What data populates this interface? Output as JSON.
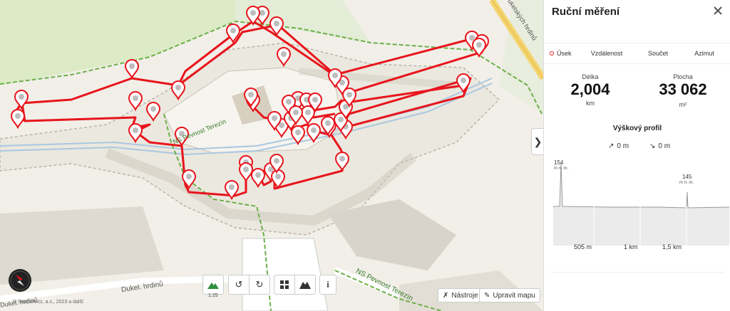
{
  "map": {
    "street_labels": [
      "Dukelských hrdinů",
      "NS Pevnost Terezín",
      "NS Pevnost Terezín",
      "Dukel. hrdinů",
      "Dukel. hrdinů"
    ],
    "copyright": "© Seznam.cz, a.s., 2023 a další",
    "zoom_label": "1:25",
    "tools_label": "Nástroje",
    "edit_label": "Upravit mapu",
    "info_label": "i",
    "route_color": "#e8141c"
  },
  "panel": {
    "title": "Ruční měření",
    "tabs": [
      "Úsek",
      "Vzdálenost",
      "Součet",
      "Azimut"
    ],
    "length_label": "Délka",
    "length_value": "2,004",
    "length_unit": "km",
    "area_label": "Plocha",
    "area_value": "33 062",
    "area_unit": "m²",
    "profile_title": "Výškový profil",
    "ascent": "0 m",
    "descent": "0 m",
    "peak1_value": "154",
    "peak1_unit": "m n. m.",
    "peak2_value": "145",
    "peak2_unit": "m n. m.",
    "x_ticks": [
      "505 m",
      "1 km",
      "1,5 km"
    ]
  }
}
